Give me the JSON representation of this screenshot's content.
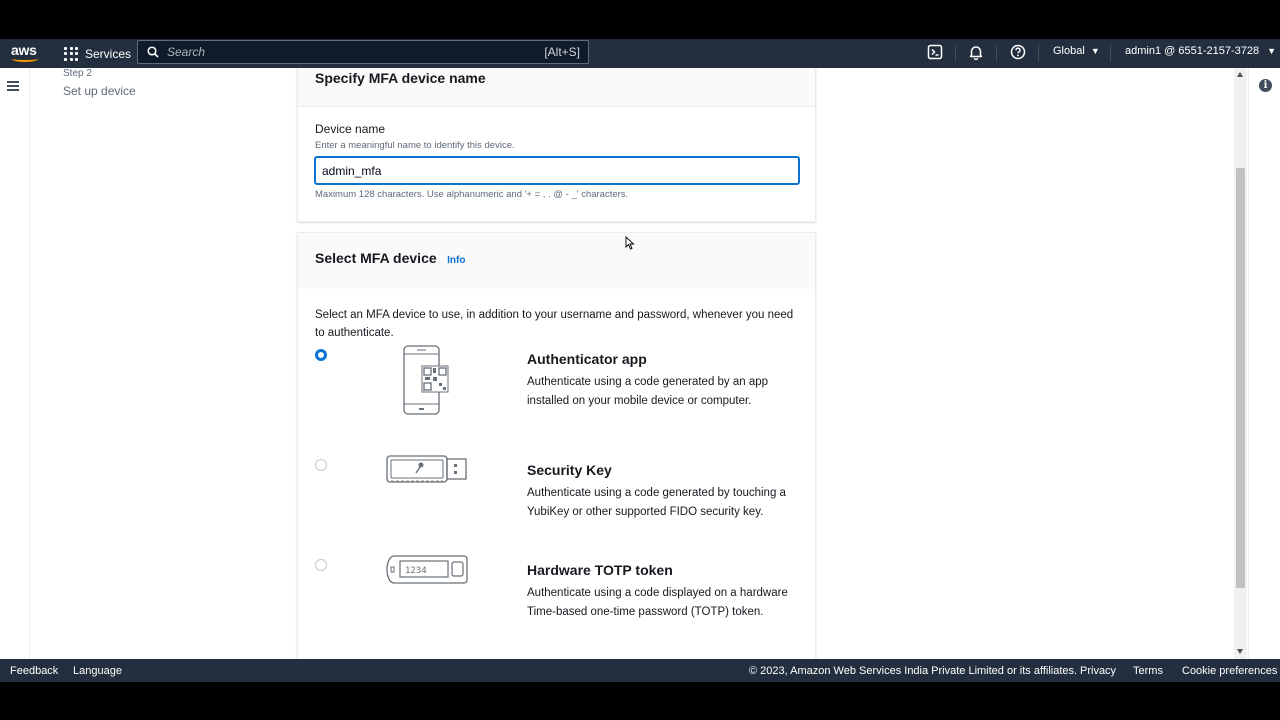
{
  "topnav": {
    "logo_text": "aws",
    "services_label": "Services",
    "search_placeholder": "Search",
    "search_shortcut": "[Alt+S]",
    "region_label": "Global",
    "account_label": "admin1 @ 6551-2157-3728"
  },
  "wizard": {
    "step_number": "Step 2",
    "step_title": "Set up device"
  },
  "device_name_section": {
    "title": "Specify MFA device name",
    "field_label": "Device name",
    "field_description": "Enter a meaningful name to identify this device.",
    "field_value": "admin_mfa",
    "field_constraint": "Maximum 128 characters. Use alphanumeric and '+ = , . @ - _' characters."
  },
  "mfa_device_section": {
    "title": "Select MFA device",
    "info_link": "Info",
    "description": "Select an MFA device to use, in addition to your username and password, whenever you need to authenticate.",
    "options": [
      {
        "title": "Authenticator app",
        "description": "Authenticate using a code generated by an app installed on your mobile device or computer.",
        "selected": true,
        "icon": "phone-qr-icon"
      },
      {
        "title": "Security Key",
        "description": "Authenticate using a code generated by touching a YubiKey or other supported FIDO security key.",
        "selected": false,
        "icon": "usb-key-icon"
      },
      {
        "title": "Hardware TOTP token",
        "description": "Authenticate using a code displayed on a hardware Time-based one-time password (TOTP) token.",
        "selected": false,
        "icon": "totp-token-icon",
        "token_display": "1234"
      }
    ]
  },
  "footer": {
    "feedback": "Feedback",
    "language": "Language",
    "copyright": "© 2023, Amazon Web Services India Private Limited or its affiliates.",
    "privacy": "Privacy",
    "terms": "Terms",
    "cookie_preferences": "Cookie preferences"
  },
  "colors": {
    "nav_bg": "#232f3e",
    "accent": "#0972d3",
    "brand_orange": "#ff9900"
  }
}
